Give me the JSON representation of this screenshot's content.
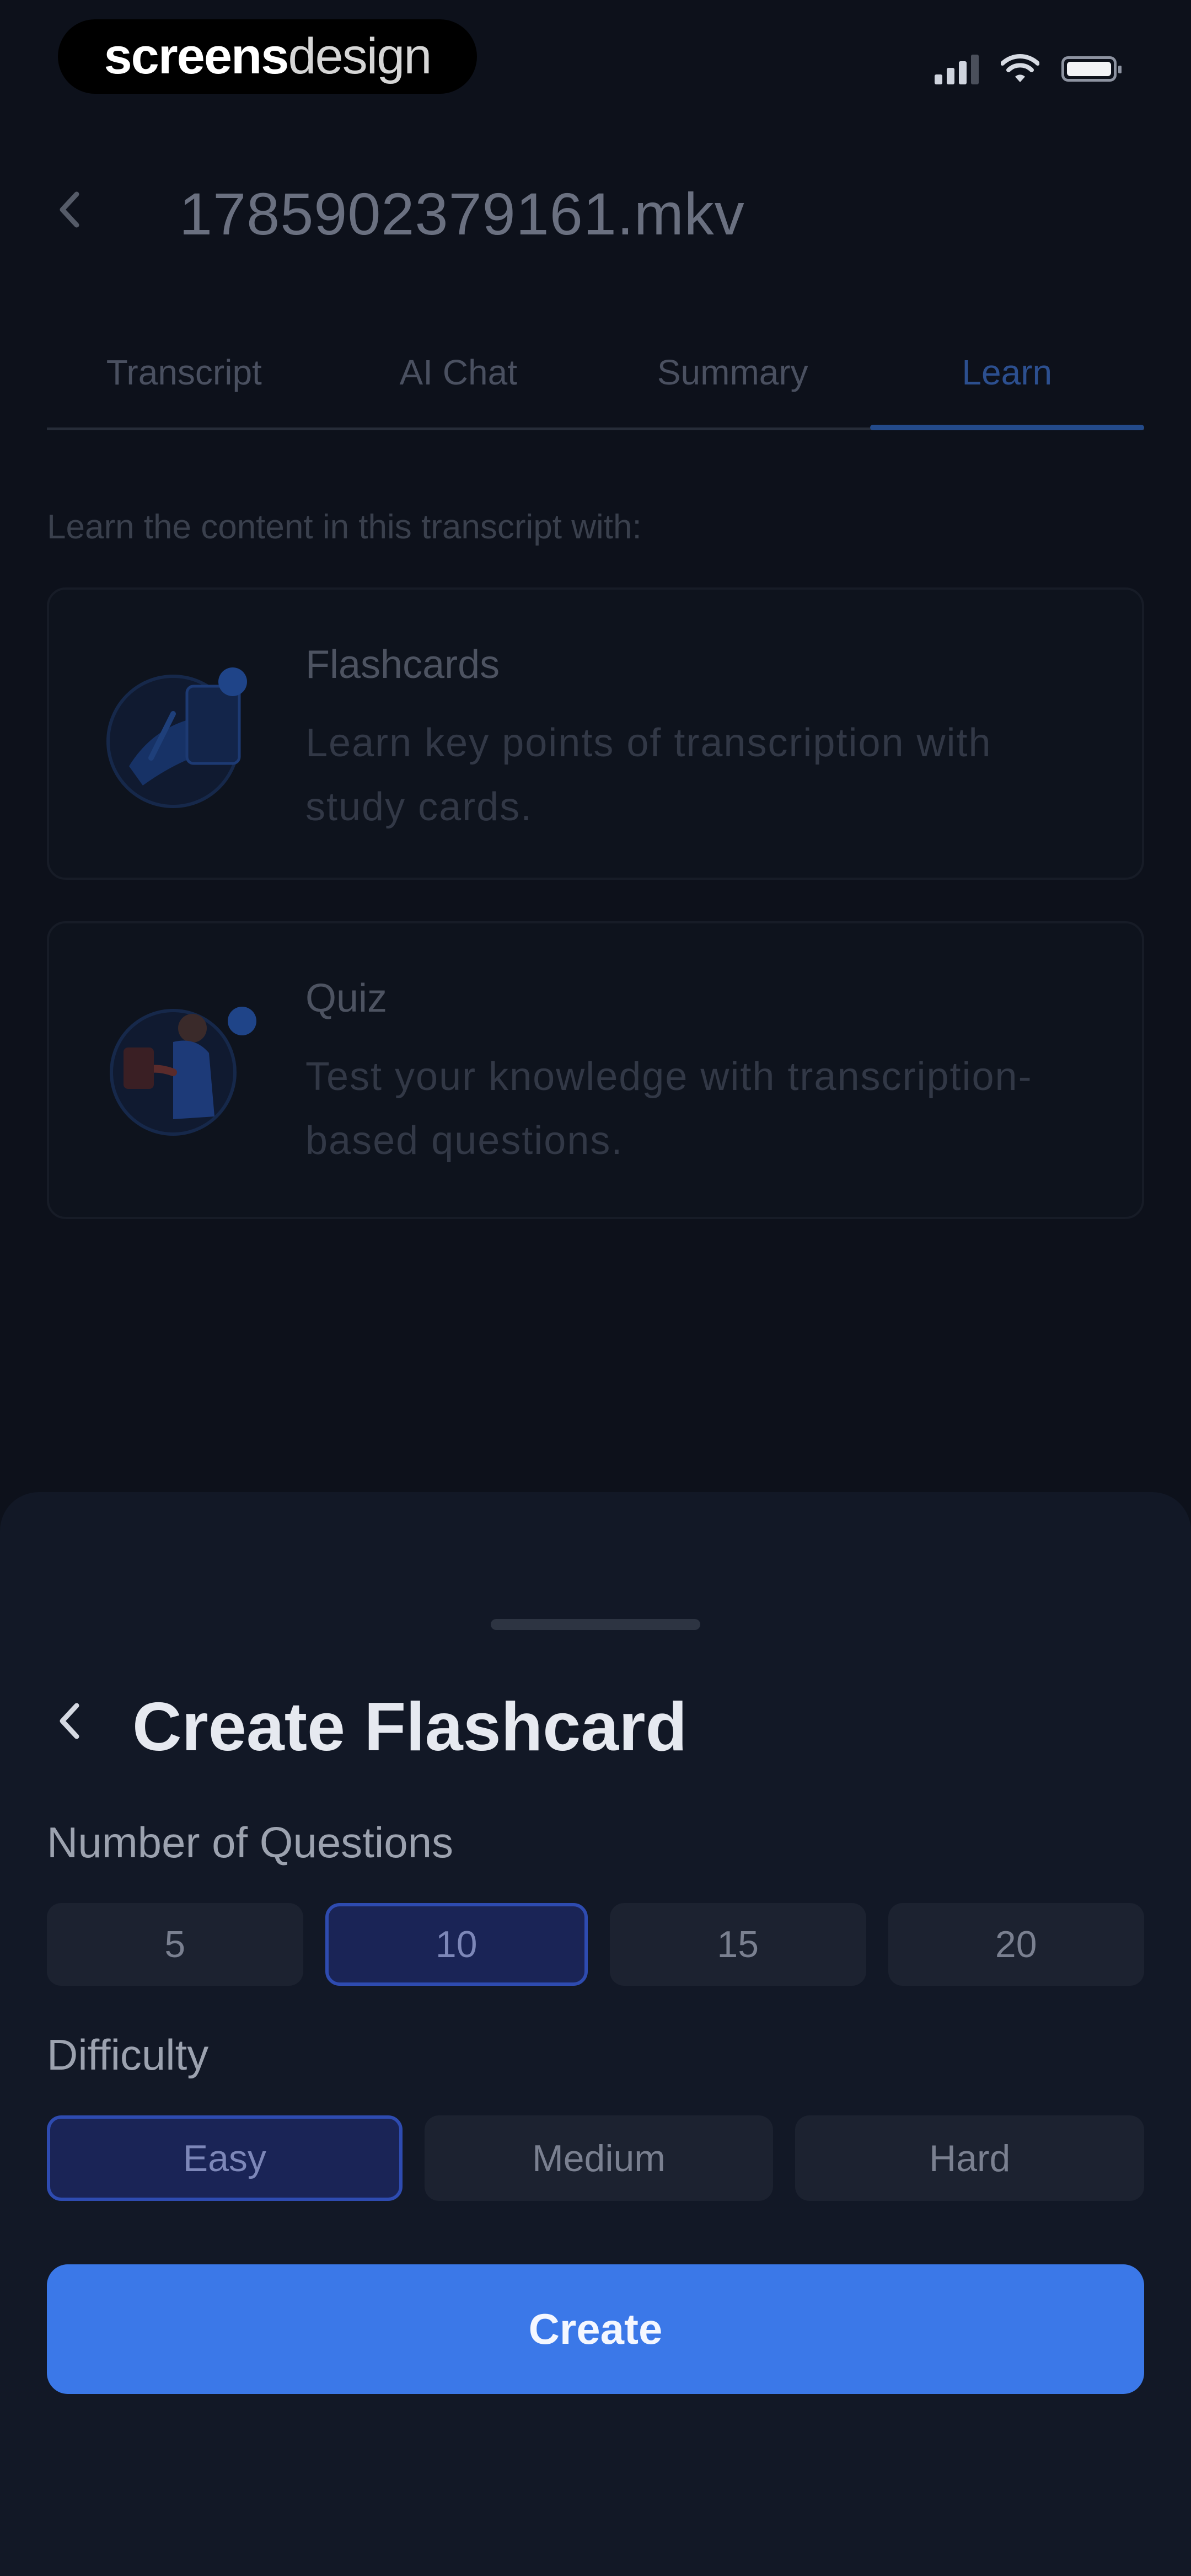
{
  "status_bar": {
    "brand_strong": "screens",
    "brand_light": "design",
    "icons": [
      "signal-icon",
      "wifi-icon",
      "battery-icon"
    ]
  },
  "header": {
    "back_icon": "chevron-left-icon",
    "title": "1785902379161.mkv"
  },
  "tabs": [
    {
      "label": "Transcript",
      "active": false
    },
    {
      "label": "AI Chat",
      "active": false
    },
    {
      "label": "Summary",
      "active": false
    },
    {
      "label": "Learn",
      "active": true
    }
  ],
  "learn": {
    "intro": "Learn the content in this transcript with:",
    "cards": [
      {
        "title": "Flashcards",
        "description": "Learn key points of transcription with study cards."
      },
      {
        "title": "Quiz",
        "description": "Test your knowledge with transcription-based questions."
      }
    ]
  },
  "sheet": {
    "back_icon": "chevron-left-icon",
    "title": "Create Flashcard",
    "questions_label": "Number of Questions",
    "question_options": [
      "5",
      "10",
      "15",
      "20"
    ],
    "selected_question_count": "10",
    "difficulty_label": "Difficulty",
    "difficulty_options": [
      "Easy",
      "Medium",
      "Hard"
    ],
    "selected_difficulty": "Easy",
    "create_label": "Create"
  },
  "colors": {
    "background": "#0d111b",
    "sheet": "#121826",
    "accent": "#3b78e8",
    "selected_option": "#1a2456"
  }
}
